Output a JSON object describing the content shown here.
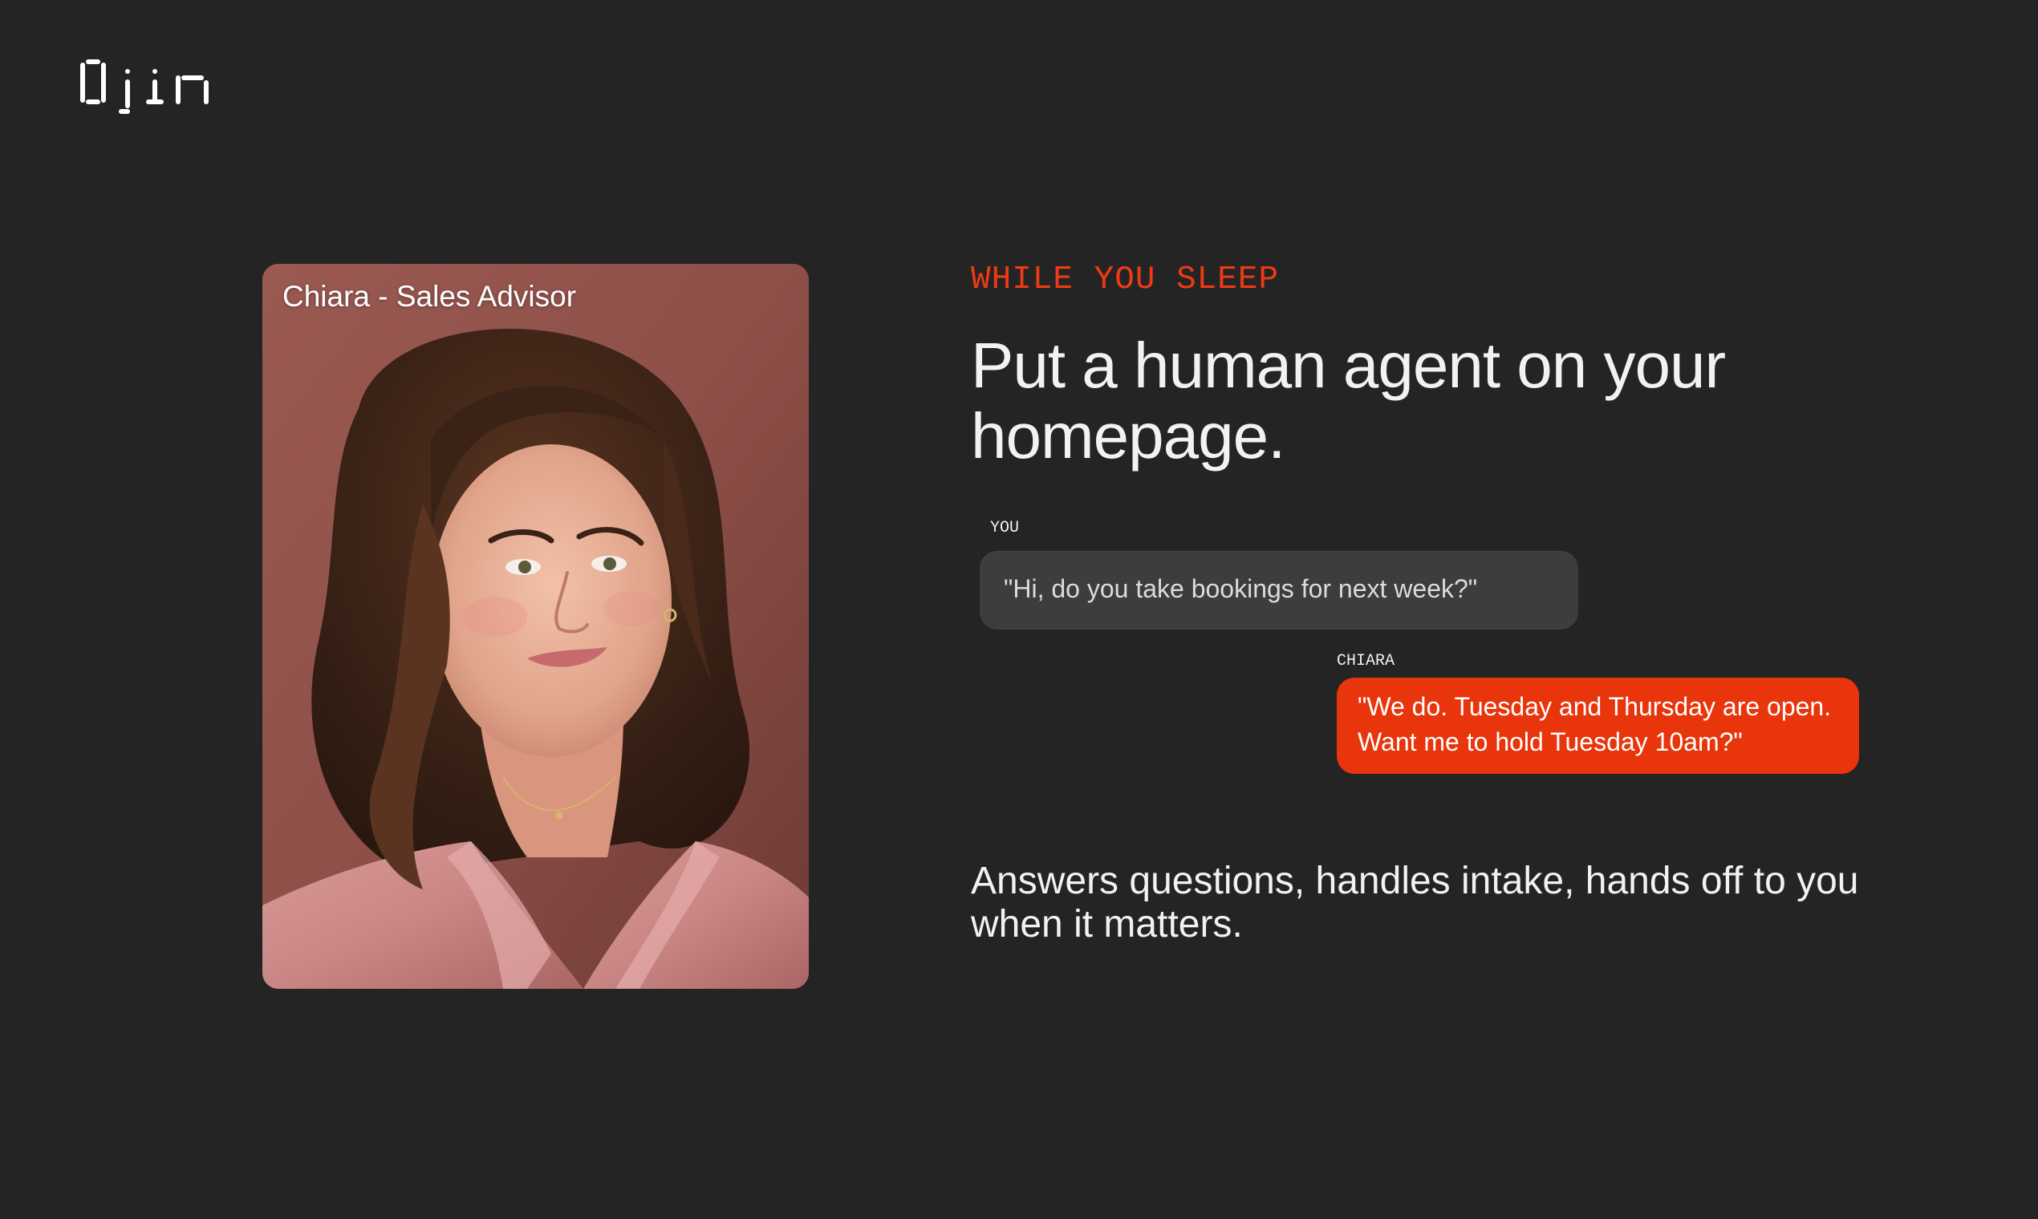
{
  "brand": {
    "logo_text": "Ojin"
  },
  "agent_card": {
    "label": "Chiara - Sales Advisor"
  },
  "hero": {
    "eyebrow": "WHILE YOU SLEEP",
    "headline": "Put a human agent on your homepage."
  },
  "conversation": {
    "messages": [
      {
        "speaker": "YOU",
        "text": "\"Hi, do you take bookings for next week?\""
      },
      {
        "speaker": "CHIARA",
        "text": "\"We do. Tuesday and Thursday are open. Want me to hold Tuesday 10am?\""
      }
    ]
  },
  "description": "Answers questions, handles intake, hands off to you when it matters.",
  "colors": {
    "background": "#242424",
    "accent": "#e8350c",
    "user_bubble": "#3d3d3d",
    "text": "#f2f2f2"
  }
}
